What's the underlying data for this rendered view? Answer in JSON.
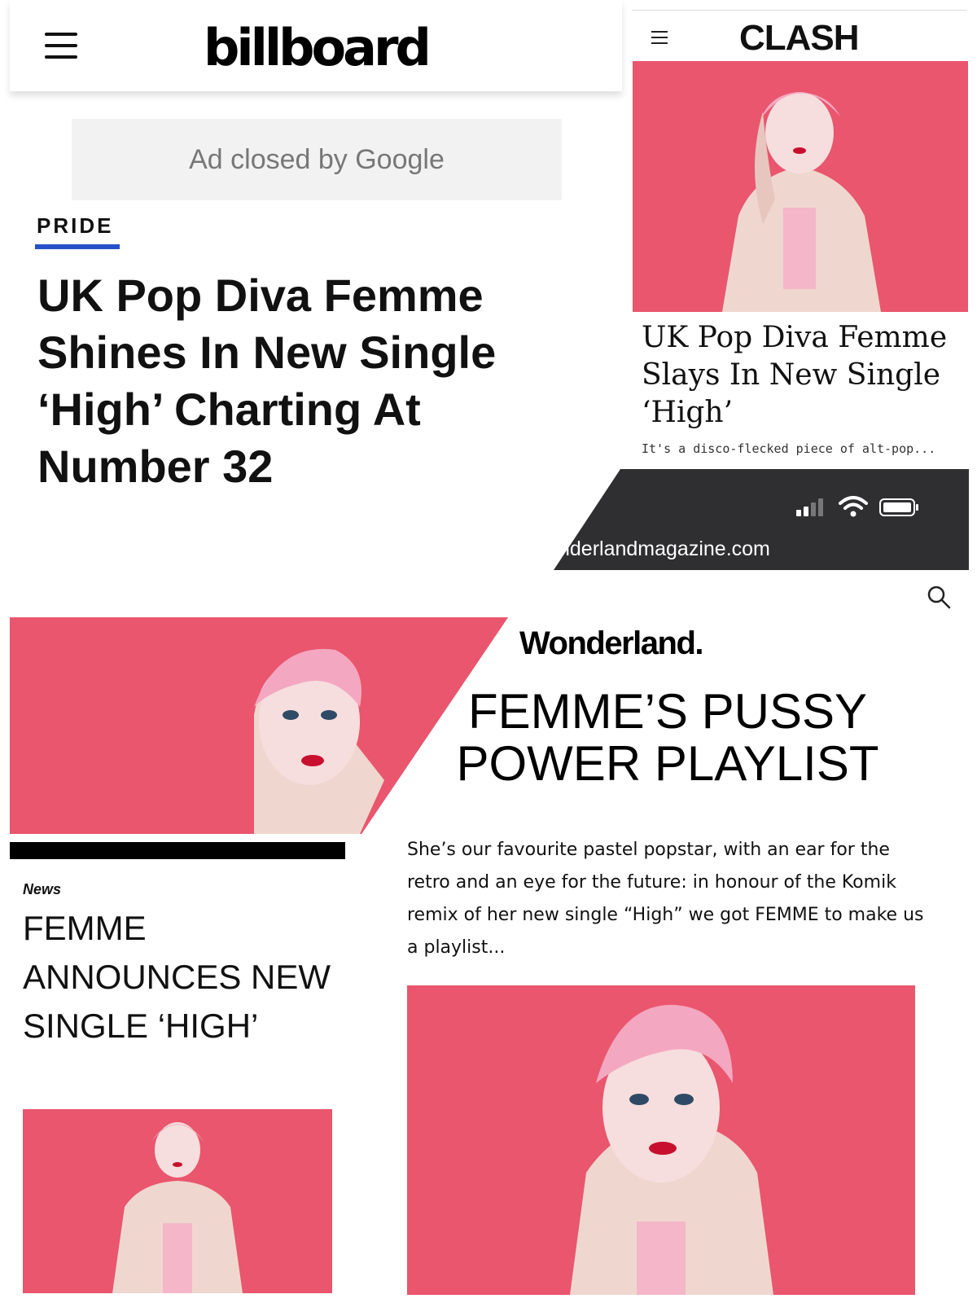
{
  "billboard": {
    "logo": "billboard",
    "ad_text": "Ad closed by Google",
    "kicker": "PRIDE",
    "headline": "UK Pop Diva Femme Shines In New Single ‘High’ Charting At Number 32",
    "colors": {
      "kicker_bar": "#2851c7"
    }
  },
  "clash": {
    "logo": "CLASH",
    "headline": "UK Pop Diva Femme Slays In New Single ‘High’",
    "excerpt": "It's a disco-flecked piece of alt-pop..."
  },
  "phone": {
    "url": "nderlandmagazine.com",
    "icons": [
      "signal-icon",
      "wifi-icon",
      "battery-icon"
    ]
  },
  "left_article": {
    "tag": "News",
    "headline": "FEMME ANNOUNCES NEW SINGLE ‘HIGH’"
  },
  "wonderland": {
    "logo": "Wonderland.",
    "headline": "FEMME’S PUSSY POWER PLAYLIST",
    "intro": "She’s our favourite pastel popstar, with an ear for the retro and an eye for the future: in honour of the Komik remix of her new single “High” we got FEMME to make us a playlist...",
    "icons": [
      "search-icon"
    ]
  },
  "colors": {
    "photo_background": "#e9566d",
    "hair": "#f4a7c0"
  }
}
